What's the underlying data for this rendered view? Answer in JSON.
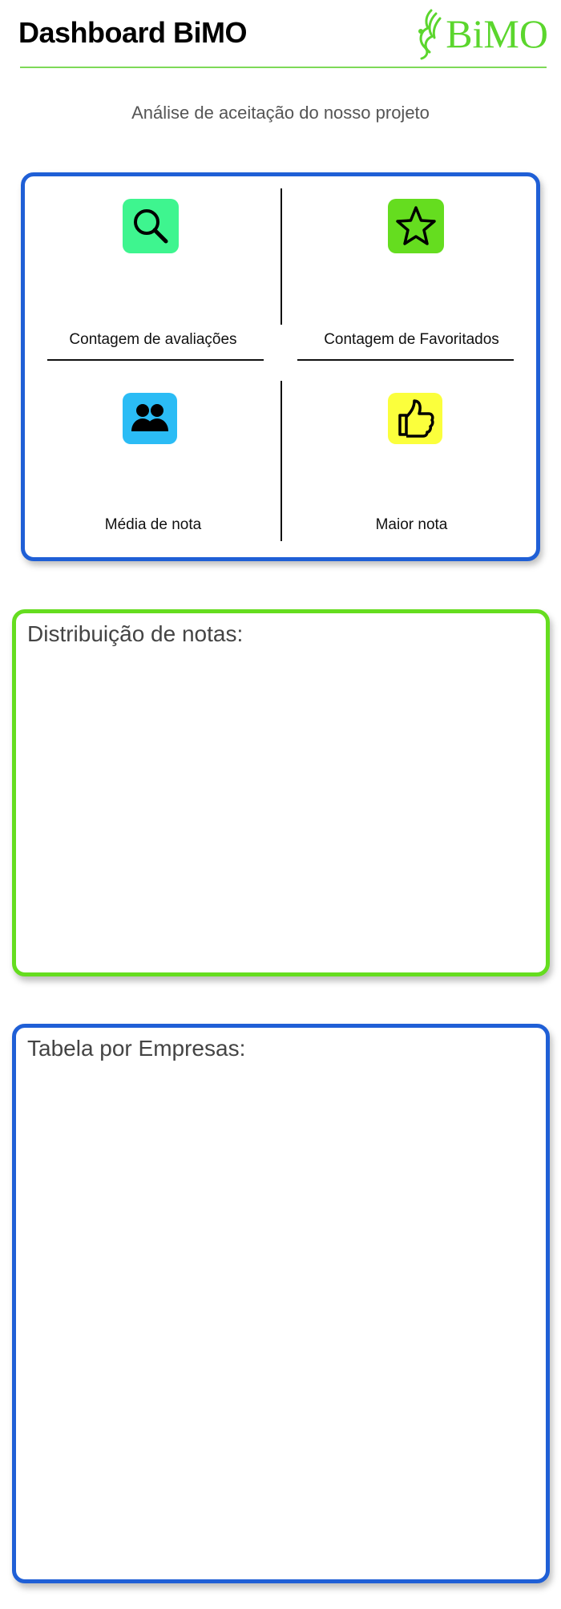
{
  "header": {
    "title": "Dashboard BiMO",
    "logo_text": "BiMO",
    "logo_icon": "phoenix-wing-icon",
    "accent_color": "#7ed957"
  },
  "subtitle": "Análise de aceitação do nosso projeto",
  "stats": {
    "border_color": "#1f5fd6",
    "items": [
      {
        "label": "Contagem de avaliações",
        "icon": "search-icon",
        "color": "#3ef58f"
      },
      {
        "label": "Contagem de Favoritados",
        "icon": "star-icon",
        "color": "#65dd1f"
      },
      {
        "label": "Média de nota",
        "icon": "users-icon",
        "color": "#2bbcf5"
      },
      {
        "label": "Maior nota",
        "icon": "thumbs-up-icon",
        "color": "#fbff3c"
      }
    ]
  },
  "panels": {
    "distribution": {
      "title": "Distribuição de notas:",
      "border_color": "#65dd1f"
    },
    "table": {
      "title": "Tabela por Empresas:",
      "border_color": "#1f5fd6"
    }
  }
}
